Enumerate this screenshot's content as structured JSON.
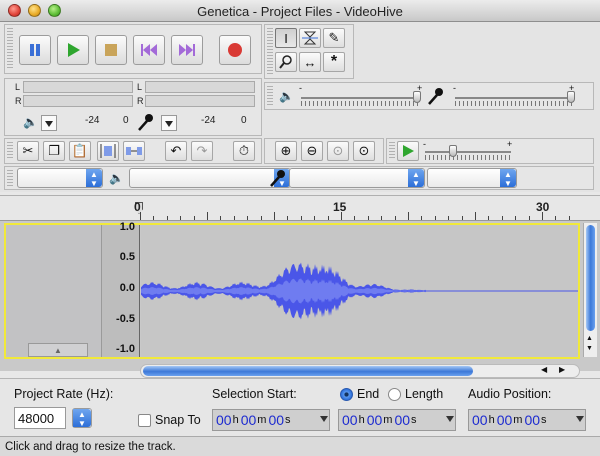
{
  "window": {
    "title": "Genetica - Project Files - VideoHive"
  },
  "meters": {
    "left_channel": "L",
    "right_channel": "R",
    "scale_low": "-24",
    "scale_zero": "0"
  },
  "ruler": {
    "labels": [
      "0",
      "15",
      "30"
    ]
  },
  "track": {
    "scale": [
      "1.0",
      "0.5",
      "0.0",
      "-0.5",
      "-1.0"
    ]
  },
  "selection": {
    "rate_label": "Project Rate (Hz):",
    "rate_value": "48000",
    "snap_label": "Snap To",
    "selection_start_label": "Selection Start:",
    "end_label": "End",
    "length_label": "Length",
    "audio_position_label": "Audio Position:",
    "time_h": "00",
    "time_m": "00",
    "time_s": "00",
    "unit_h": "h",
    "unit_m": "m",
    "unit_s": "s"
  },
  "status": "Click and drag to resize the track.",
  "colors": {
    "waveform": "#4a56e8",
    "waveform_core": "#6f7cf0",
    "track_border": "#f1e93a",
    "accent": "#2c6ed8"
  }
}
